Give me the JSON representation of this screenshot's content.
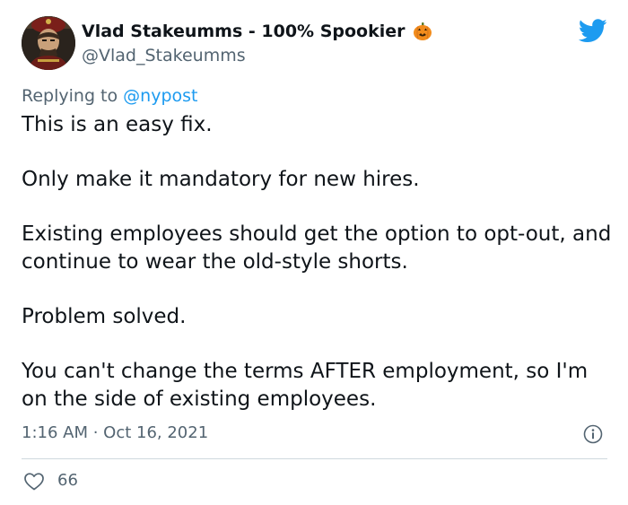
{
  "author": {
    "display_name": "Vlad Stakeumms - 100% Spookier",
    "handle": "@Vlad_Stakeumms",
    "avatar_icon": "portrait-avatar",
    "badge_icon": "jack-o-lantern-icon"
  },
  "reply": {
    "prefix": "Replying to",
    "mention": "@nypost"
  },
  "tweet": {
    "paragraphs": [
      "This is an easy fix.",
      "Only make it mandatory for new hires.",
      "Existing employees should get the option to opt-out, and continue to wear the old-style shorts.",
      "Problem solved.",
      "You can't change the terms AFTER employment, so I'm on the side of existing employees."
    ],
    "timestamp": "1:16 AM · Oct 16, 2021"
  },
  "engagement": {
    "likes": "66"
  },
  "colors": {
    "brand": "#1d9bf0",
    "text": "#0f1419",
    "muted": "#536471",
    "divider": "#cfd9de"
  }
}
